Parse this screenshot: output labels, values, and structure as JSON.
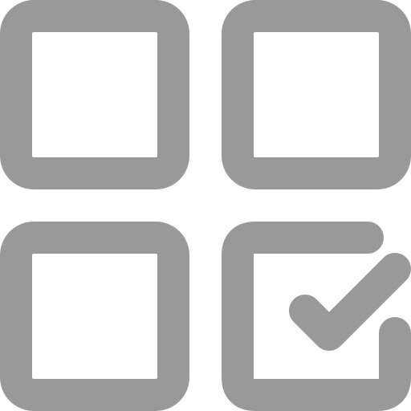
{
  "icon": {
    "name": "grid-checklist-icon",
    "stroke_color": "#999999",
    "background_color": "#ffffff",
    "tiles": [
      {
        "name": "top-left-tile",
        "checked": false
      },
      {
        "name": "top-right-tile",
        "checked": false
      },
      {
        "name": "bottom-left-tile",
        "checked": false
      },
      {
        "name": "bottom-right-tile",
        "checked": true
      }
    ]
  }
}
